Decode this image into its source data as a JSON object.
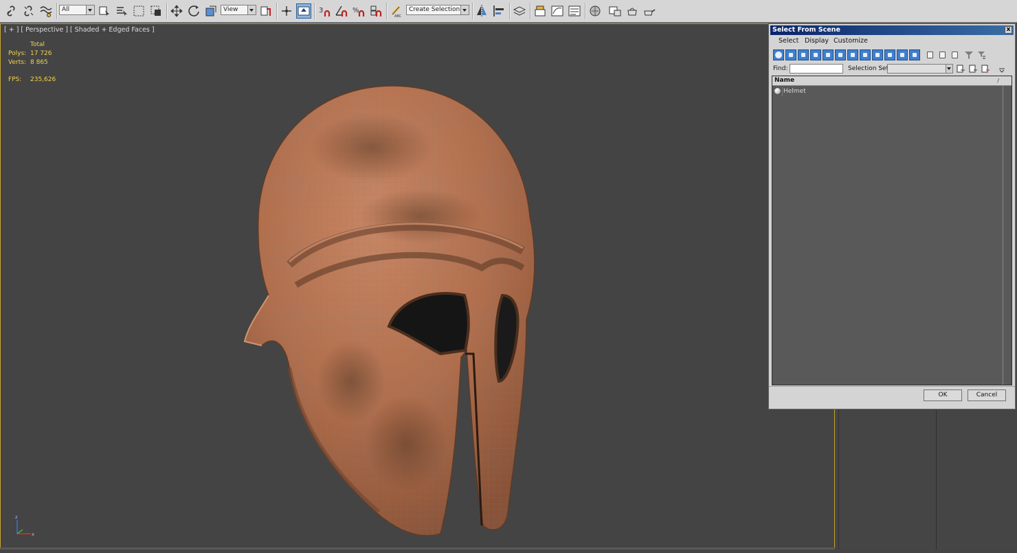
{
  "toolbar": {
    "selection_filter": "All",
    "ref_coord": "View",
    "snap_label": "3",
    "percent_label": "%",
    "selection_set_placeholder": "Create Selection Se"
  },
  "viewport": {
    "label": "[ + ] [ Perspective ] [ Shaded + Edged Faces ]",
    "stats": {
      "total_label": "Total",
      "polys_label": "Polys:",
      "polys_value": "17 726",
      "verts_label": "Verts:",
      "verts_value": "8 865",
      "fps_label": "FPS:",
      "fps_value": "235,626"
    },
    "axis_z": "z",
    "axis_x": "x"
  },
  "dialog": {
    "title": "Select From Scene",
    "close": "x",
    "menu": [
      "Select",
      "Display",
      "Customize"
    ],
    "find_label": "Find:",
    "selection_set_label": "Selection Set:",
    "list_header": "Name",
    "sort_mark": "/",
    "items": [
      {
        "name": "Helmet"
      }
    ],
    "ok": "OK",
    "cancel": "Cancel"
  },
  "colors": {
    "viewport_bg": "#444444",
    "stats_text": "#f2d34f",
    "active_border": "#c8a62e",
    "title_bar": "#0a246a",
    "helmet_copper": "#b8724e"
  }
}
